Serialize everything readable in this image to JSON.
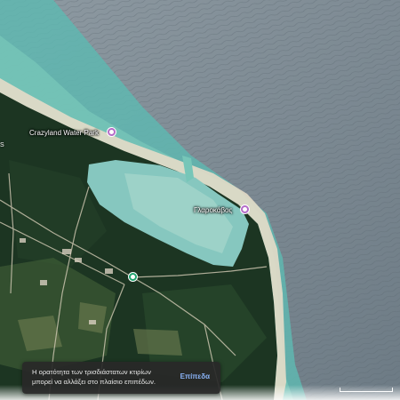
{
  "map": {
    "type": "satellite",
    "colors": {
      "sea_deep": "#7d8a94",
      "sea_shallow": "#5fb7b0",
      "beach": "#e4dcc8",
      "forest": "#1c3522",
      "lagoon": "#86c7bf"
    },
    "edge_letter": "S"
  },
  "pois": [
    {
      "label": "Crazyland Water Park",
      "icon": "water-park-pin-icon",
      "color": "#b46cc8"
    },
    {
      "label": "Γλαροκάβος",
      "icon": "place-pin-icon",
      "color": "#b46cc8"
    },
    {
      "label": "",
      "icon": "transit-pin-icon",
      "color": "#1ea46e"
    }
  ],
  "toast": {
    "message": "Η ορατότητα των τρισδιάστατων κτιρίων μπορεί να αλλάξει στο πλαίσιο επιπέδων.",
    "action": "Επίπεδα"
  }
}
